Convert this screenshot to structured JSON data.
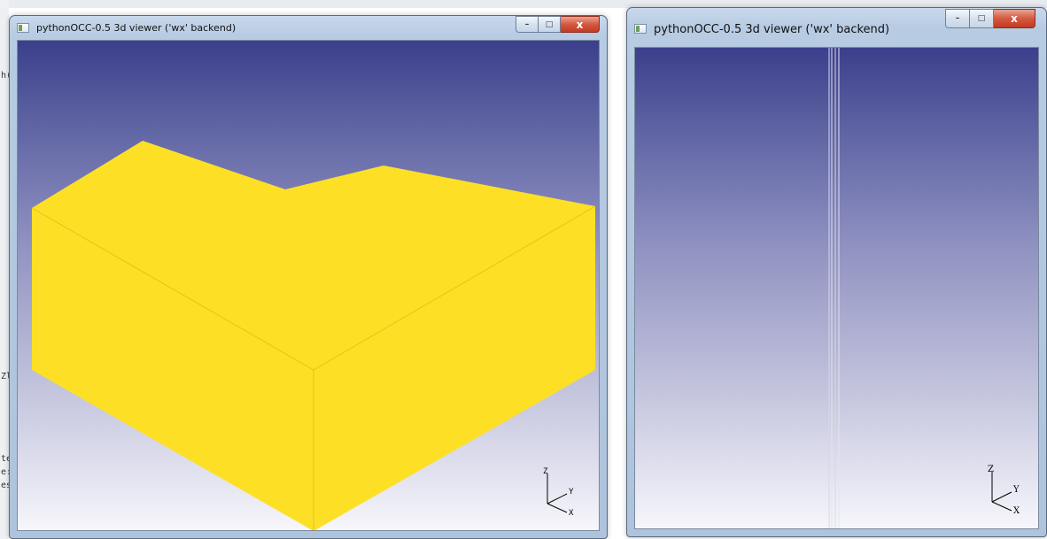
{
  "windows": [
    {
      "title": "pythonOCC-0.5 3d viewer ('wx' backend)",
      "controls": {
        "minimize": "–",
        "maximize": "□",
        "close": "x"
      },
      "model": {
        "shape": "l-shaped-box",
        "color": "#fde026"
      },
      "triedron": {
        "z": "Z",
        "y": "Y",
        "x": "X"
      }
    },
    {
      "title": "pythonOCC-0.5 3d viewer ('wx' backend)",
      "controls": {
        "minimize": "–",
        "maximize": "□",
        "close": "x"
      },
      "model": {
        "shape": "thin-vertical-lines",
        "color": "#d8d8e4"
      },
      "triedron": {
        "z": "Z",
        "y": "Y",
        "x": "X"
      }
    }
  ],
  "background_fragments": [
    "h(",
    "Zl",
    "te",
    "e:",
    "es"
  ]
}
